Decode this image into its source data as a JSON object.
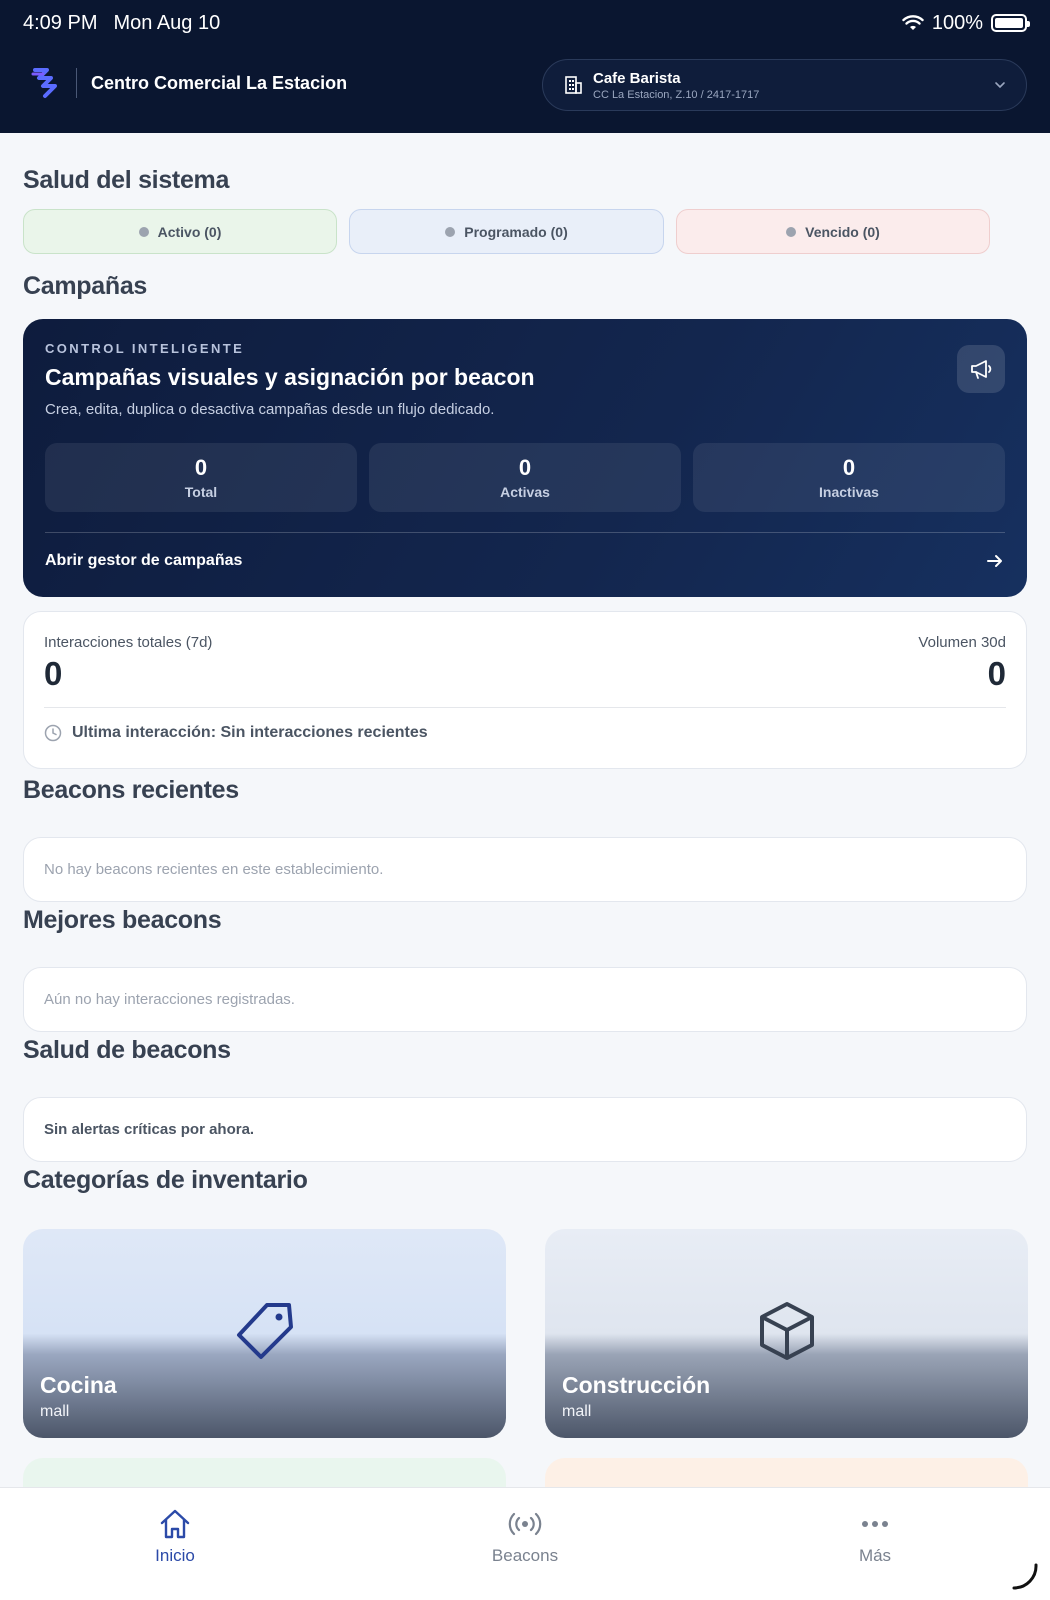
{
  "statusbar": {
    "time": "4:09 PM",
    "date": "Mon Aug 10",
    "battery": "100%"
  },
  "header": {
    "mall_name": "Centro Comercial La Estacion",
    "store": {
      "name": "Cafe Barista",
      "detail": "CC La Estacion, Z.10 / 2417-1717"
    }
  },
  "system_health": {
    "title": "Salud del sistema",
    "active": "Activo (0)",
    "scheduled": "Programado (0)",
    "expired": "Vencido (0)"
  },
  "campaigns": {
    "title": "Campañas",
    "eyebrow": "CONTROL INTELIGENTE",
    "heading": "Campañas visuales y asignación por beacon",
    "description": "Crea, edita, duplica o desactiva campañas desde un flujo dedicado.",
    "stats": [
      {
        "value": "0",
        "label": "Total"
      },
      {
        "value": "0",
        "label": "Activas"
      },
      {
        "value": "0",
        "label": "Inactivas"
      }
    ],
    "link": "Abrir gestor de campañas"
  },
  "interactions": {
    "total_label": "Interacciones totales (7d)",
    "total_value": "0",
    "volume_label": "Volumen 30d",
    "volume_value": "0",
    "last": "Ultima interacción: Sin interacciones recientes"
  },
  "recent_beacons": {
    "title": "Beacons recientes",
    "empty": "No hay beacons recientes en este establecimiento."
  },
  "top_beacons": {
    "title": "Mejores beacons",
    "empty": "Aún no hay interacciones registradas."
  },
  "beacon_health": {
    "title": "Salud de beacons",
    "message": "Sin alertas críticas por ahora."
  },
  "inventory": {
    "title": "Categorías de inventario",
    "categories": [
      {
        "name": "Cocina",
        "sub": "mall",
        "icon": "tag-icon"
      },
      {
        "name": "Construcción",
        "sub": "mall",
        "icon": "cube-icon"
      }
    ]
  },
  "tabbar": {
    "home": "Inicio",
    "beacons": "Beacons",
    "more": "Más"
  },
  "colors": {
    "header_bg": "#0a1630",
    "accent": "#2b4aa8"
  }
}
